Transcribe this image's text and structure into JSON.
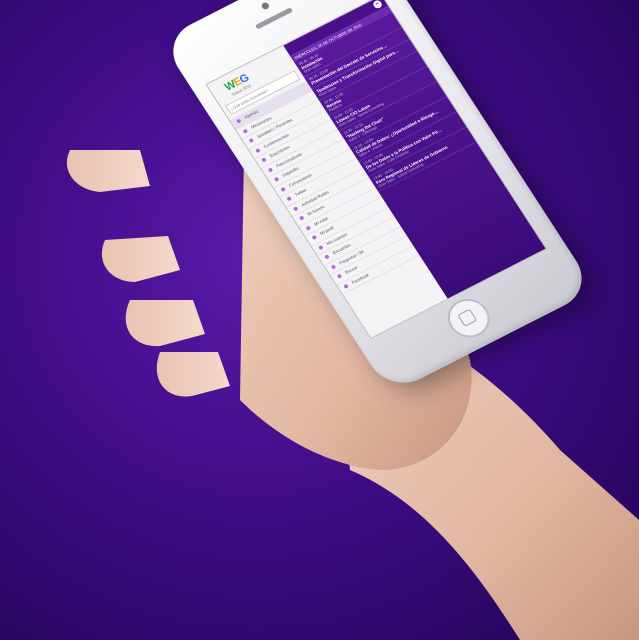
{
  "app": {
    "logo_text": "WEG",
    "tagline": "Sobre 2016",
    "search_placeholder": "¿Qué estás buscando?"
  },
  "menu": {
    "items": [
      "Agenda",
      "Ministrantes",
      "Speakers / Ponentes",
      "Conferencistas",
      "Expositores",
      "Patrocinadores",
      "Sugestão",
      "Convocatoria",
      "Twitter",
      "Actividad Redes",
      "Mi horario",
      "Mi votar",
      "Mi perfil",
      "Mis cuentas",
      "Encuestas",
      "Preguntas / Mi",
      "Buscar",
      "Facebook"
    ]
  },
  "agenda": {
    "date_label": "MIÉRCOLES, 05 DE OCTUBRE DE 2016",
    "close_icon": "×",
    "events": [
      {
        "time": "08:45 - 09:15",
        "name": "Instalación",
        "sub": "Gran Salón"
      },
      {
        "time": "09:15 - 10:00",
        "name": "Presentación del Decreto de Servicios…",
        "sub": ""
      },
      {
        "time": "",
        "name": "Tendencias y Transformación Digital para…",
        "sub": "Gran Salón"
      },
      {
        "time": "10:45 - 11:00",
        "name": "Receso",
        "sub": "Pasillo A"
      },
      {
        "time": "11:00 - 11:30",
        "name": "Líneas CIO Latam",
        "sub": "Gran Salón - Speed Consulting"
      },
      {
        "time": "11:30 - 12:15",
        "name": "\"Hacking the Chair\"",
        "sub": "Salón 1 - Liderazgo"
      },
      {
        "time": "12:15 - 13:00",
        "name": "Calidad de Datos: ¿Oportunidad o Riesgo…",
        "sub": "Salón 4 - Interior"
      },
      {
        "time": "13:00 - 13:45",
        "name": "De los Datos a la Política con Valor Pú…",
        "sub": "Gran Salón - Café Charlado"
      },
      {
        "time": "13:45 - 14:30",
        "name": "Foro Regional de Líderes de Gobierno",
        "sub": "Gran Salón - Speed Consulting"
      }
    ]
  },
  "colors": {
    "background": "#3f0c86",
    "agenda_panel": "#4b0f8c",
    "logo_accent": "#d3268e"
  }
}
